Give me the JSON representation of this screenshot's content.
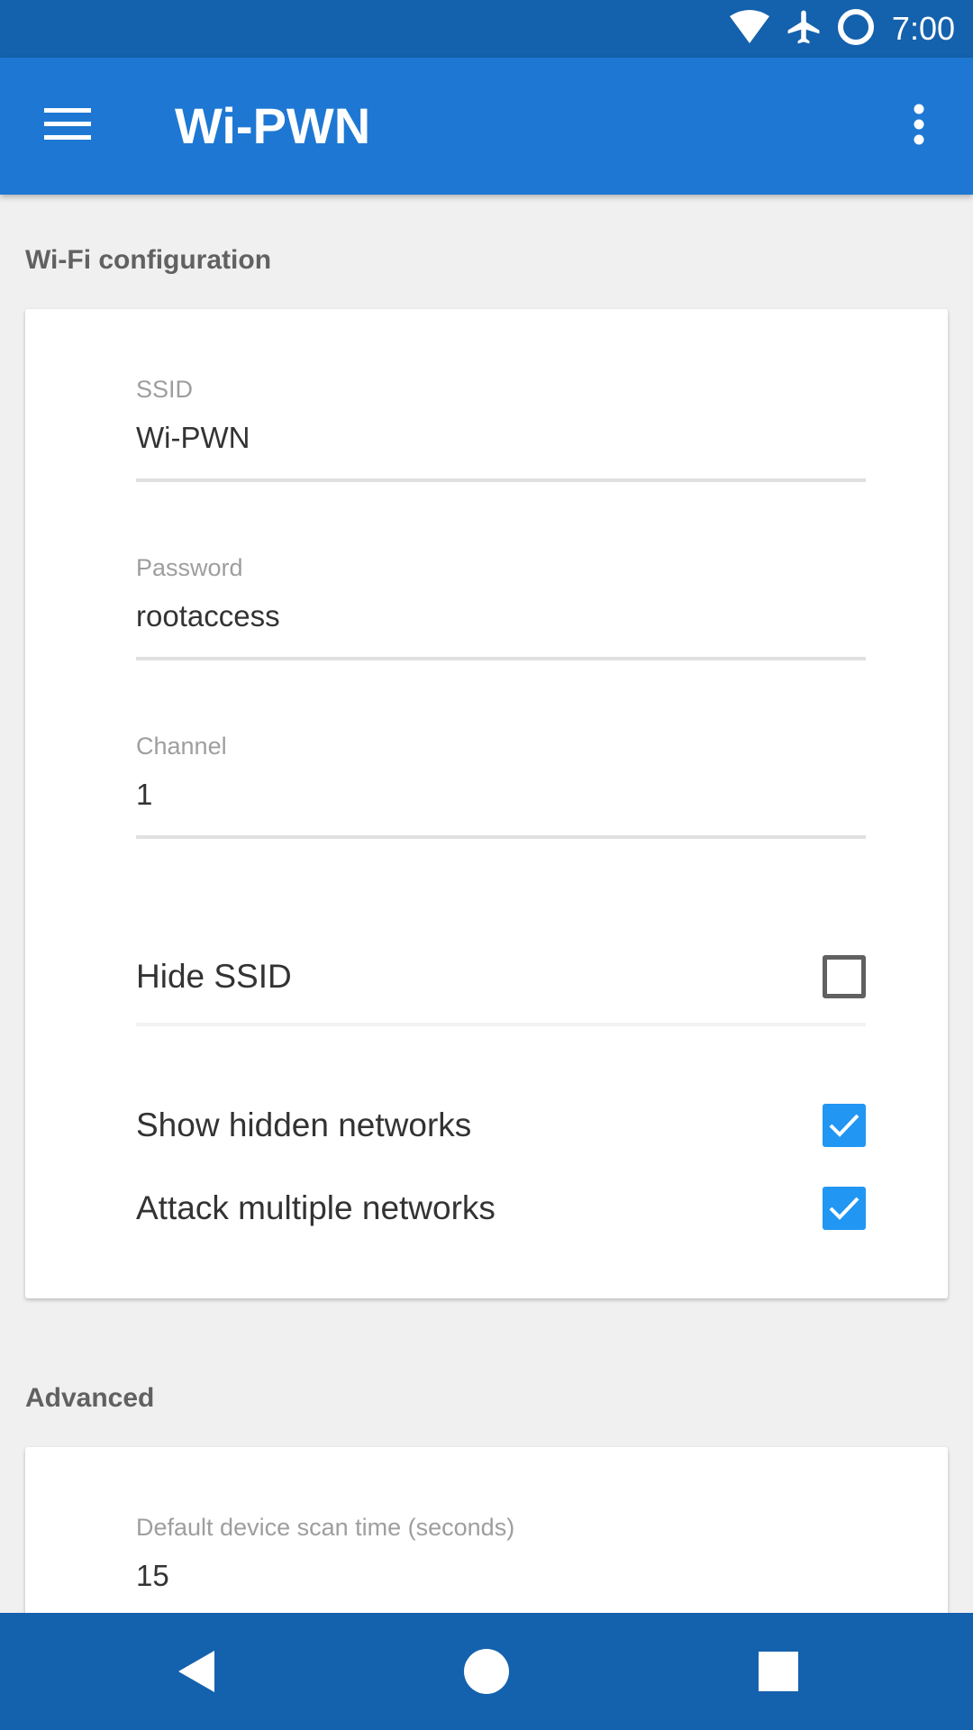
{
  "status_bar": {
    "time": "7:00",
    "icons": [
      "wifi-icon",
      "airplane-mode-icon",
      "sync-circle-icon"
    ]
  },
  "app_bar": {
    "title": "Wi-PWN",
    "menu_icon": "hamburger-menu-icon",
    "overflow_icon": "more-vertical-icon"
  },
  "sections": {
    "wifi": {
      "header": "Wi-Fi configuration",
      "ssid": {
        "label": "SSID",
        "value": "Wi-PWN"
      },
      "password": {
        "label": "Password",
        "value": "rootaccess"
      },
      "channel": {
        "label": "Channel",
        "value": "1"
      },
      "hide_ssid": {
        "label": "Hide SSID",
        "checked": false
      },
      "show_hidden": {
        "label": "Show hidden networks",
        "checked": true
      },
      "attack_multiple": {
        "label": "Attack multiple networks",
        "checked": true
      }
    },
    "advanced": {
      "header": "Advanced",
      "scan_time": {
        "label": "Default device scan time (seconds)",
        "value": "15"
      }
    }
  },
  "nav_bar": {
    "icons": [
      "back-icon",
      "home-icon",
      "recents-icon"
    ]
  },
  "colors": {
    "status_bar": "#1461ad",
    "app_bar": "#1e78d3",
    "checkbox_checked": "#2196f3",
    "background": "#f0f0f0"
  }
}
